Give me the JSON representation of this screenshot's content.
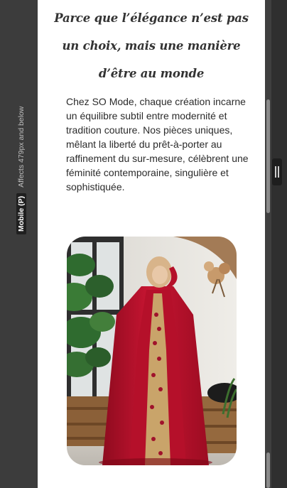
{
  "breakpoint": {
    "name": "Mobile (P)",
    "description": "Affects 479px and below"
  },
  "content": {
    "tagline_lines": [
      "Parce que l’élégance n’est pas",
      "un choix, mais une manière",
      "d’être au monde"
    ],
    "paragraph": "Chez SO Mode, chaque création incarne un équilibre subtil entre modernité et tradition couture. Nos pièces uniques, mêlant la liberté du prêt-à-porter au raffinement du sur-mesure, célèbrent une féminité contemporaine, singulière et sophistiquée."
  },
  "colors": {
    "editor_bg": "#3c3c3c",
    "canvas_bg": "#ffffff",
    "dress_red": "#c4122e",
    "text_dark": "#2b2b2b"
  }
}
